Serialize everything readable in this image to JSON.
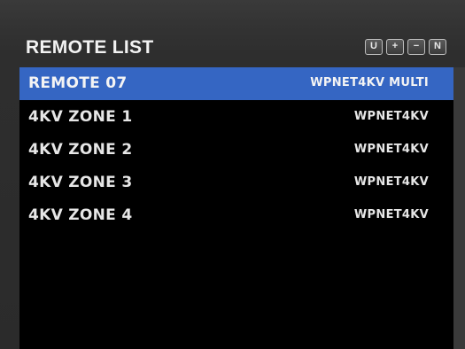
{
  "panel": {
    "title": "REMOTE LIST",
    "buttons": [
      {
        "label": "U",
        "icon": "u-letter-icon"
      },
      {
        "label": "+",
        "icon": "plus-icon"
      },
      {
        "label": "−",
        "icon": "minus-icon"
      },
      {
        "label": "N",
        "icon": "n-letter-icon"
      }
    ]
  },
  "list": {
    "selected_index": 0,
    "items": [
      {
        "name": "REMOTE 07",
        "type": "WPNET4KV MULTI"
      },
      {
        "name": "4KV ZONE 1",
        "type": "WPNET4KV"
      },
      {
        "name": "4KV ZONE 2",
        "type": "WPNET4KV"
      },
      {
        "name": "4KV ZONE 3",
        "type": "WPNET4KV"
      },
      {
        "name": "4KV ZONE 4",
        "type": "WPNET4KV"
      }
    ]
  },
  "colors": {
    "selection": "#3566c3",
    "list_background": "#000000",
    "text": "#e6e6e6"
  }
}
